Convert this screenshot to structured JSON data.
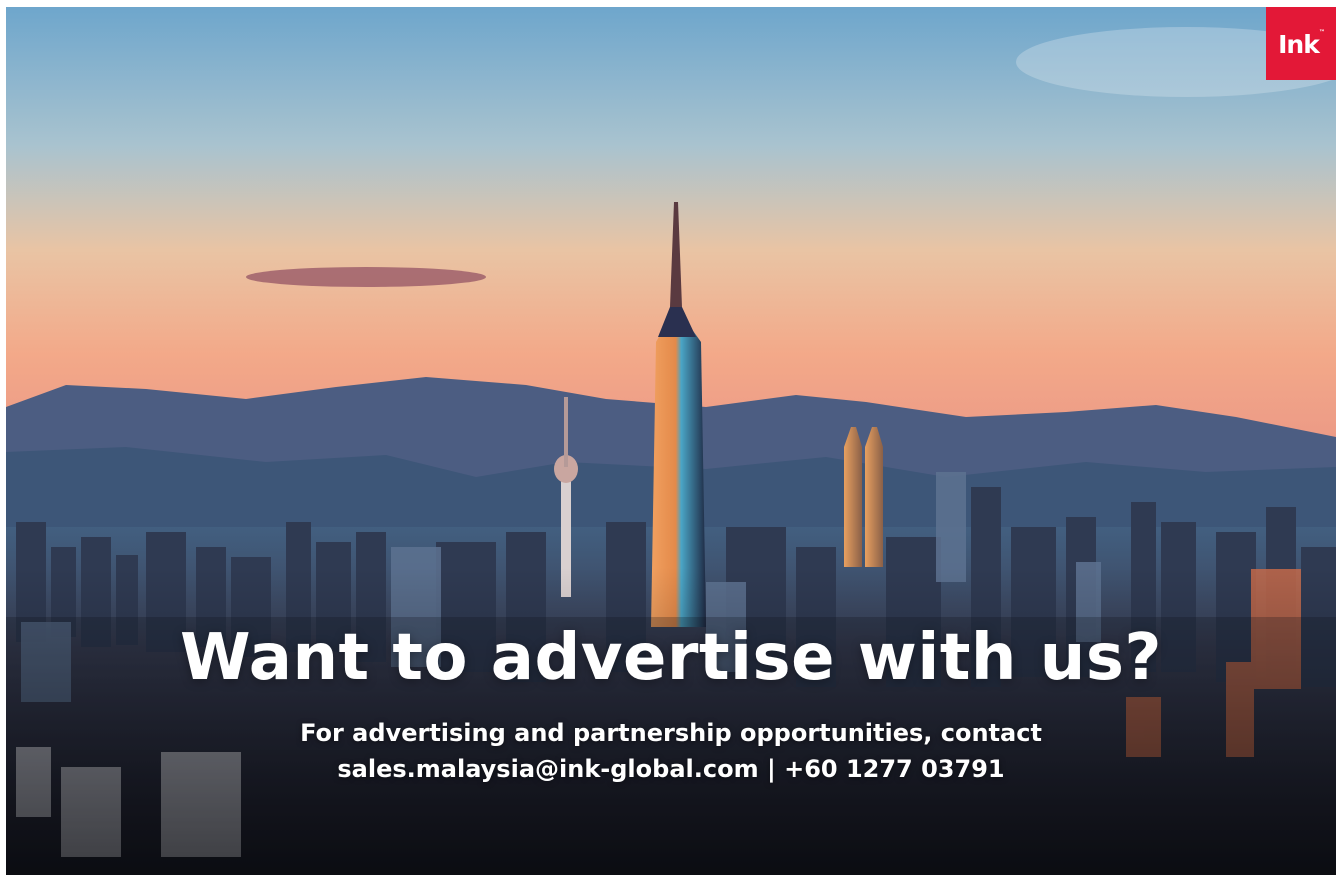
{
  "brand": {
    "logo_text": "Ink",
    "logo_mark": "™",
    "color": "#e31837"
  },
  "ad": {
    "headline": "Want to advertise with us?",
    "subtext_line1": "For advertising and partnership opportunities, contact",
    "email": "sales.malaysia@ink-global.com",
    "separator": " | ",
    "phone": "+60 1277 03791"
  },
  "background": {
    "image": "kuala-lumpur-skyline-sunset"
  }
}
